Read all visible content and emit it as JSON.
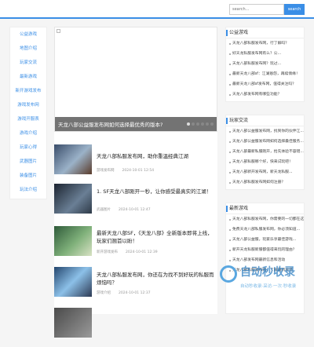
{
  "search": {
    "placeholder": "search...",
    "button_label": "search"
  },
  "leftnav": {
    "items": [
      "公益游戏",
      "地图介绍",
      "玩家交流",
      "最新游戏",
      "新开游戏发布",
      "游戏发布网",
      "游戏开服表",
      "游戏介绍",
      "玩家心得",
      "武器图片",
      "装备图片",
      "玩法介绍"
    ]
  },
  "slider": {
    "caption": "天龙八部公益服发布网如何选择最优秀的版本?",
    "dots": 6
  },
  "articles": [
    {
      "title": "天龙八部私服发布网，助你重温经典江湖",
      "source": "游戏发布网",
      "date": "2024-10-01 12:54"
    },
    {
      "title": "1. SF天龙八部刚开一秒，让你感受最真实的江湖！",
      "source": "武器图片",
      "date": "2024-10-01 12:47"
    },
    {
      "title": "最新天龙八部SF，《天龙八部》全新版本即将上线，玩家们翘首以盼！",
      "source": "新开游戏发布",
      "date": "2024-10-01 12:39"
    },
    {
      "title": "天龙八部私服发布网，你还在为找不到好玩的私服而烦恼吗？",
      "source": "游戏介绍",
      "date": "2024-10-01 12:37"
    }
  ],
  "sidebar": {
    "sections": [
      {
        "heading": "公益游戏",
        "items": [
          "天龙八部私服发布网，行了解吗？",
          "好天龙私服发布网有么？公...",
          "天龙八部私服发布网？玩过...",
          "最新天龙八部sf：江湖恩怨，再续情缘！",
          "最新天龙八部sf发布网，值得关注吗？",
          "天龙八部发布网有哪些功能？"
        ]
      },
      {
        "heading": "玩家交流",
        "items": [
          "天龙八部公益服发布网，找到你的伙伴江...",
          "天龙八部公益服发布网如何选择最佳服务...",
          "天龙八部最新私服刚开，抢先体验不容错...",
          "天龙八部私服哪个好，快来试玩吧！",
          "天龙八部新开发布网，新天龙私服...",
          "天龙八部私服发布网如何注册？"
        ]
      },
      {
        "heading": "最新游戏",
        "items": [
          "天龙八部私服发布网，你需要的一切都在这里！",
          "免费天龙八部私服发布网，你必须知道...",
          "天龙八部公益服，玩家乐享最佳游戏...",
          "新开天龙私服新服都值得来玩的理由？",
          "天龙八部发布网最新信息和活动",
          "天龙八部私服发布网，了解最新资讯"
        ]
      }
    ]
  },
  "watermark": {
    "text": "自动秒收录",
    "sub": "自动秒收录·采访·一次·秒收录"
  },
  "colors": {
    "accent": "#3a8ee6"
  }
}
